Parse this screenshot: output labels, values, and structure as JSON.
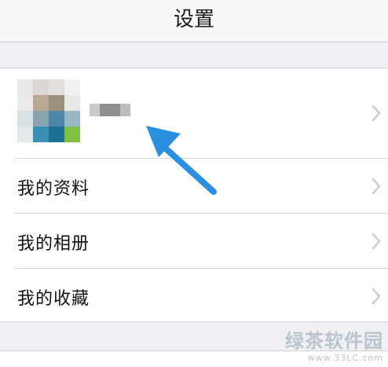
{
  "nav": {
    "title": "设置"
  },
  "menu": [
    {
      "label": "我的资料"
    },
    {
      "label": "我的相册"
    },
    {
      "label": "我的收藏"
    }
  ],
  "icons": {
    "chevron": "chevron-right-icon",
    "arrow": "arrow-icon"
  },
  "colors": {
    "arrow": "#2a8fe0",
    "chevron": "#c7c7cc"
  },
  "watermark": {
    "brand": "绿茶软件园",
    "url": "www.33LC.com"
  }
}
